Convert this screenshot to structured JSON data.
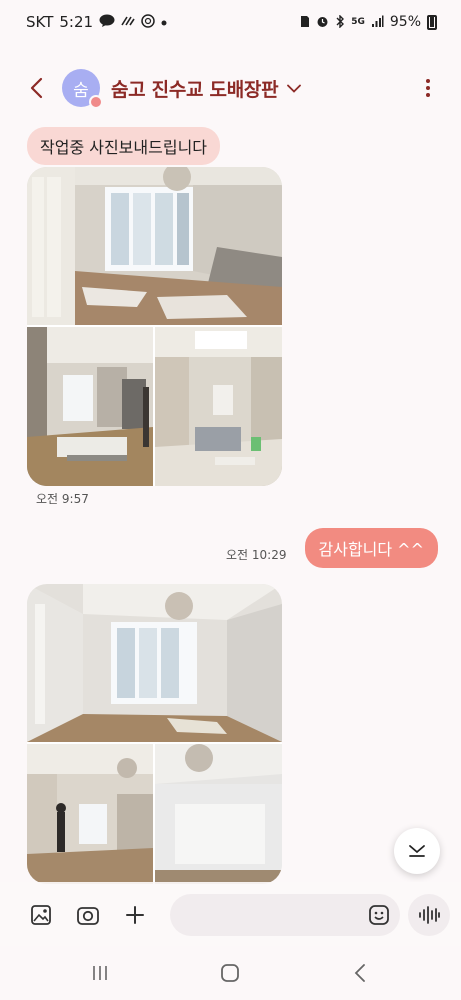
{
  "status_bar": {
    "carrier": "SKT",
    "time": "5:21",
    "battery": "95%",
    "network": "5G"
  },
  "header": {
    "avatar_initial": "숨",
    "title": "숨고 진수교 도배장판"
  },
  "messages": {
    "incoming_text": "작업중 사진보내드립니다",
    "photo_time_1": "오전 9:57",
    "outgoing_time": "오전 10:29",
    "outgoing_text": "감사합니다 ^^"
  },
  "input": {
    "placeholder": ""
  },
  "colors": {
    "title": "#8c2a26",
    "incoming_bubble": "#f9d8d4",
    "outgoing_bubble": "#f28b81",
    "background": "#fcf8f9"
  },
  "icons": [
    "back-arrow-icon",
    "chevron-down-icon",
    "more-vert-icon",
    "gallery-icon",
    "camera-icon",
    "plus-icon",
    "emoji-icon",
    "voice-wave-icon",
    "scroll-down-icon",
    "nav-recents-icon",
    "nav-home-icon",
    "nav-back-icon"
  ]
}
